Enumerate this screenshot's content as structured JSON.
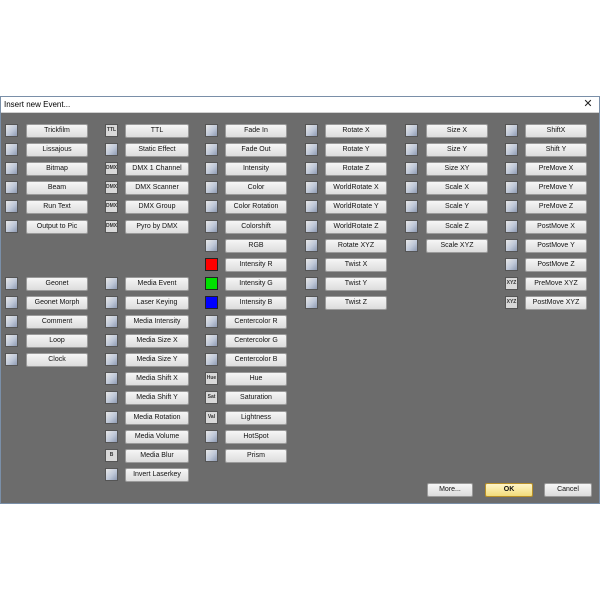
{
  "window": {
    "title": "Insert new Event...",
    "close": "✕"
  },
  "colors": {
    "dialog_bg": "#6c6c6c",
    "button_bg": "#e6e6e6",
    "ok_border": "#b8902a"
  },
  "columns": [
    {
      "items": [
        {
          "label": "Trickfilm",
          "icon": "film-strip-icon"
        },
        {
          "label": "Lissajous",
          "icon": "lissajous-icon"
        },
        {
          "label": "Bitmap",
          "icon": "bitmap-icon"
        },
        {
          "label": "Beam",
          "icon": "beam-icon"
        },
        {
          "label": "Run Text",
          "icon": "run-text-icon"
        },
        {
          "label": "Output to Pic",
          "icon": "output-to-pic-icon"
        },
        null,
        null,
        {
          "label": "Geonet",
          "icon": "geonet-icon"
        },
        {
          "label": "Geonet Morph",
          "icon": "geonet-morph-icon"
        },
        {
          "label": "Comment",
          "icon": "comment-icon"
        },
        {
          "label": "Loop",
          "icon": "loop-icon"
        },
        {
          "label": "Clock",
          "icon": "hourglass-icon"
        }
      ]
    },
    {
      "items": [
        {
          "label": "TTL",
          "icon": "ttl-icon",
          "text": "TTL"
        },
        {
          "label": "Static Effect",
          "icon": "static-effect-icon"
        },
        {
          "label": "DMX 1 Channel",
          "icon": "dmx-icon",
          "text": "DMX"
        },
        {
          "label": "DMX Scanner",
          "icon": "dmx-scanner-icon",
          "text": "DMX"
        },
        {
          "label": "DMX Group",
          "icon": "dmx-group-icon",
          "text": "DMX"
        },
        {
          "label": "Pyro by DMX",
          "icon": "pyro-icon",
          "text": "DMX"
        },
        null,
        null,
        {
          "label": "Media Event",
          "icon": "media-event-icon"
        },
        {
          "label": "Laser Keying",
          "icon": "laser-keying-icon"
        },
        {
          "label": "Media Intensity",
          "icon": "media-intensity-icon"
        },
        {
          "label": "Media Size X",
          "icon": "media-size-x-icon"
        },
        {
          "label": "Media Size Y",
          "icon": "media-size-y-icon"
        },
        {
          "label": "Media Shift X",
          "icon": "media-shift-x-icon"
        },
        {
          "label": "Media Shift Y",
          "icon": "media-shift-y-icon"
        },
        {
          "label": "Media Rotation",
          "icon": "media-rotation-icon"
        },
        {
          "label": "Media Volume",
          "icon": "media-volume-icon"
        },
        {
          "label": "Media Blur",
          "icon": "media-blur-icon",
          "text": "B"
        },
        {
          "label": "Invert Laserkey",
          "icon": "invert-laserkey-icon"
        }
      ]
    },
    {
      "items": [
        {
          "label": "Fade In",
          "icon": "fade-in-icon"
        },
        {
          "label": "Fade Out",
          "icon": "fade-out-icon"
        },
        {
          "label": "Intensity",
          "icon": "intensity-icon"
        },
        {
          "label": "Color",
          "icon": "color-icon"
        },
        {
          "label": "Color Rotation",
          "icon": "color-rotation-icon"
        },
        {
          "label": "Colorshift",
          "icon": "colorshift-icon"
        },
        {
          "label": "RGB",
          "icon": "rgb-icon"
        },
        {
          "label": "Intensity R",
          "icon": "red-square-icon",
          "color": "#ff0000"
        },
        {
          "label": "Intensity G",
          "icon": "green-square-icon",
          "color": "#00e000"
        },
        {
          "label": "Intensity B",
          "icon": "blue-square-icon",
          "color": "#0000ff"
        },
        {
          "label": "Centercolor R",
          "icon": "centercolor-r-icon"
        },
        {
          "label": "Centercolor G",
          "icon": "centercolor-g-icon"
        },
        {
          "label": "Centercolor B",
          "icon": "centercolor-b-icon"
        },
        {
          "label": "Hue",
          "icon": "hue-icon",
          "text": "Hue"
        },
        {
          "label": "Saturation",
          "icon": "saturation-icon",
          "text": "Sat"
        },
        {
          "label": "Lightness",
          "icon": "lightness-icon",
          "text": "Val"
        },
        {
          "label": "HotSpot",
          "icon": "hotspot-icon"
        },
        {
          "label": "Prism",
          "icon": "prism-icon"
        }
      ]
    },
    {
      "items": [
        {
          "label": "Rotate X",
          "icon": "rotate-x-icon"
        },
        {
          "label": "Rotate Y",
          "icon": "rotate-y-icon"
        },
        {
          "label": "Rotate Z",
          "icon": "rotate-z-icon"
        },
        {
          "label": "WorldRotate X",
          "icon": "world-rotate-x-icon"
        },
        {
          "label": "WorldRotate Y",
          "icon": "world-rotate-y-icon"
        },
        {
          "label": "WorldRotate Z",
          "icon": "world-rotate-z-icon"
        },
        {
          "label": "Rotate XYZ",
          "icon": "rotate-xyz-icon"
        },
        {
          "label": "Twist X",
          "icon": "twist-x-icon"
        },
        {
          "label": "Twist Y",
          "icon": "twist-y-icon"
        },
        {
          "label": "Twist Z",
          "icon": "twist-z-icon"
        }
      ]
    },
    {
      "items": [
        {
          "label": "Size X",
          "icon": "size-x-icon"
        },
        {
          "label": "Size Y",
          "icon": "size-y-icon"
        },
        {
          "label": "Size XY",
          "icon": "size-xy-icon"
        },
        {
          "label": "Scale X",
          "icon": "scale-x-icon"
        },
        {
          "label": "Scale Y",
          "icon": "scale-y-icon"
        },
        {
          "label": "Scale Z",
          "icon": "scale-z-icon"
        },
        {
          "label": "Scale XYZ",
          "icon": "scale-xyz-icon"
        }
      ]
    },
    {
      "items": [
        {
          "label": "ShiftX",
          "icon": "shift-x-icon"
        },
        {
          "label": "Shift Y",
          "icon": "shift-y-icon"
        },
        {
          "label": "PreMove X",
          "icon": "premove-x-icon"
        },
        {
          "label": "PreMove Y",
          "icon": "premove-y-icon"
        },
        {
          "label": "PreMove Z",
          "icon": "premove-z-icon"
        },
        {
          "label": "PostMove X",
          "icon": "postmove-x-icon"
        },
        {
          "label": "PostMove Y",
          "icon": "postmove-y-icon"
        },
        {
          "label": "PostMove Z",
          "icon": "postmove-z-icon"
        },
        {
          "label": "PreMove XYZ",
          "icon": "premove-xyz-icon",
          "text": "XYZ"
        },
        {
          "label": "PostMove XYZ",
          "icon": "postmove-xyz-icon",
          "text": "XYZ"
        }
      ]
    }
  ],
  "footer": {
    "more": "More...",
    "ok": "OK",
    "cancel": "Cancel"
  }
}
